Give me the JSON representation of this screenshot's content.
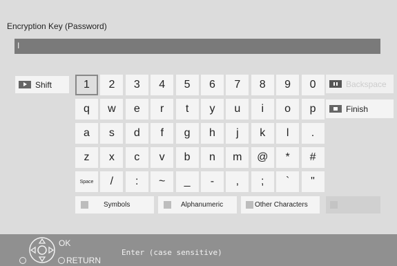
{
  "title": "Encryption Key (Password)",
  "input_value": "I",
  "keys": [
    [
      "1",
      "2",
      "3",
      "4",
      "5",
      "6",
      "7",
      "8",
      "9",
      "0"
    ],
    [
      "q",
      "w",
      "e",
      "r",
      "t",
      "y",
      "u",
      "i",
      "o",
      "p"
    ],
    [
      "a",
      "s",
      "d",
      "f",
      "g",
      "h",
      "j",
      "k",
      "l",
      "."
    ],
    [
      "z",
      "x",
      "c",
      "v",
      "b",
      "n",
      "m",
      "@",
      "*",
      "#"
    ],
    [
      "Space",
      "/",
      ":",
      "~",
      "_",
      "-",
      ",",
      ";",
      "`",
      "\""
    ]
  ],
  "side": {
    "shift": "Shift",
    "backspace": "Backspace",
    "finish": "Finish"
  },
  "modes": {
    "symbols": "Symbols",
    "alphanumeric": "Alphanumeric",
    "other": "Other Characters"
  },
  "footer": {
    "ok": "OK",
    "return": "RETURN",
    "hint": "Enter (case sensitive)"
  }
}
